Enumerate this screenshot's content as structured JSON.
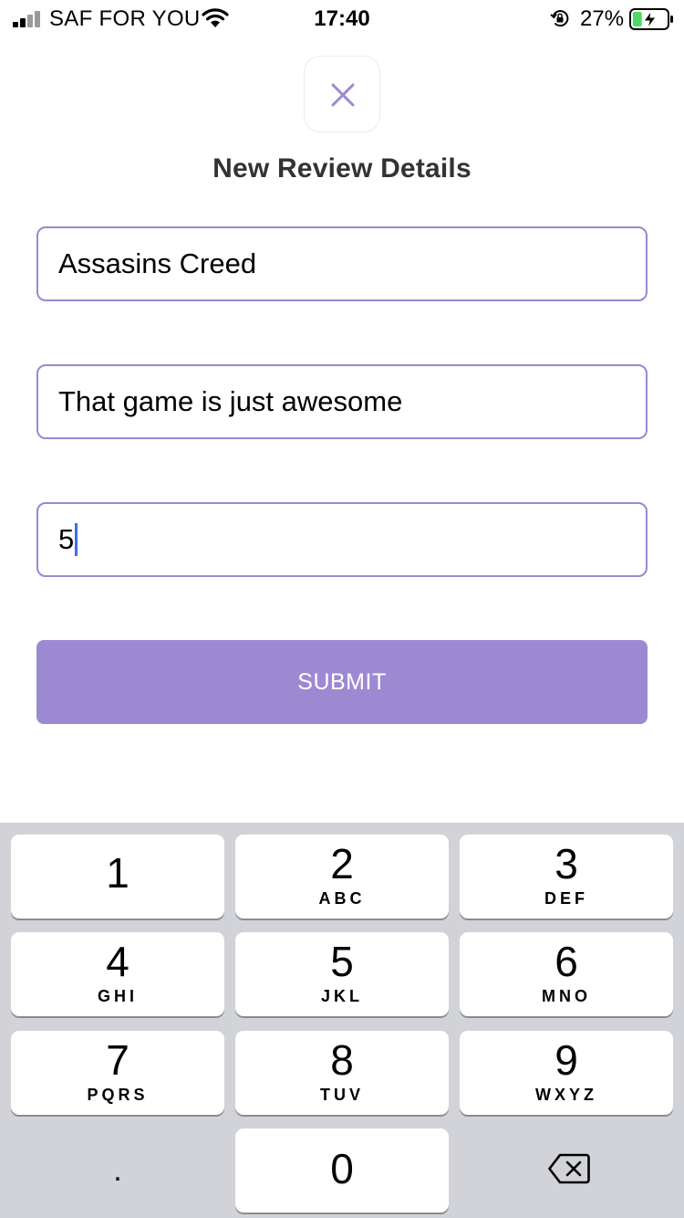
{
  "status_bar": {
    "carrier": "SAF FOR YOU",
    "time": "17:40",
    "battery_percent": "27%",
    "battery_level": 0.27,
    "battery_state": "charging",
    "icons": [
      "signal-icon",
      "wifi-icon",
      "orientation-lock-icon",
      "battery-icon"
    ]
  },
  "close_icon": "close-icon",
  "title": "New Review Details",
  "fields": [
    {
      "name": "title-field",
      "value": "Assasins Creed"
    },
    {
      "name": "body-field",
      "value": "That game is just awesome"
    },
    {
      "name": "rating-field",
      "value": "5"
    }
  ],
  "submit_label": "SUBMIT",
  "colors": {
    "accent": "#9d89d2",
    "field_border": "#9b87d3",
    "title_text": "#333333",
    "keyboard_bg": "#d1d3d9",
    "cursor": "#3a6df0"
  },
  "keypad": {
    "keys": [
      {
        "digit": "1",
        "letters": ""
      },
      {
        "digit": "2",
        "letters": "ABC"
      },
      {
        "digit": "3",
        "letters": "DEF"
      },
      {
        "digit": "4",
        "letters": "GHI"
      },
      {
        "digit": "5",
        "letters": "JKL"
      },
      {
        "digit": "6",
        "letters": "MNO"
      },
      {
        "digit": "7",
        "letters": "PQRS"
      },
      {
        "digit": "8",
        "letters": "TUV"
      },
      {
        "digit": "9",
        "letters": "WXYZ"
      },
      {
        "digit": "0",
        "letters": ""
      }
    ],
    "dot": ".",
    "backspace_icon": "backspace-icon"
  }
}
